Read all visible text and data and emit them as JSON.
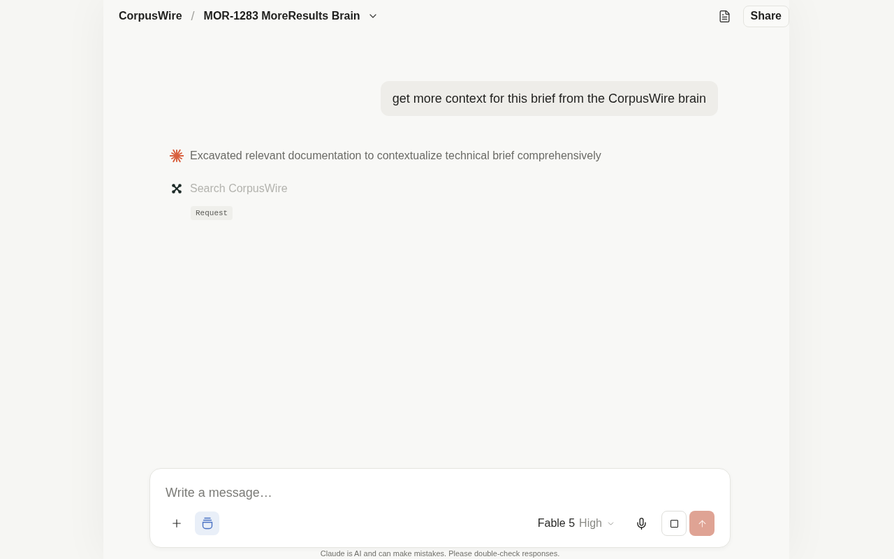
{
  "header": {
    "workspace": "CorpusWire",
    "separator": "/",
    "project": "MOR-1283 MoreResults Brain",
    "share_button": "Share"
  },
  "conversation": {
    "user_message": "get more context for this brief from the CorpusWire brain",
    "steps": [
      {
        "kind": "thought",
        "text": "Excavated relevant documentation to contextualize technical brief comprehensively",
        "pending": false
      },
      {
        "kind": "tool",
        "text": "Search CorpusWire",
        "pending": true,
        "badge": "Request"
      }
    ]
  },
  "composer": {
    "placeholder": "Write a message…",
    "knowledge_toggle": {
      "on": true
    },
    "model": "Fable 5",
    "effort": "High",
    "send_button": {
      "disabled": true
    }
  },
  "disclaimer": "Claude is AI and can make mistakes. Please double-check responses."
}
